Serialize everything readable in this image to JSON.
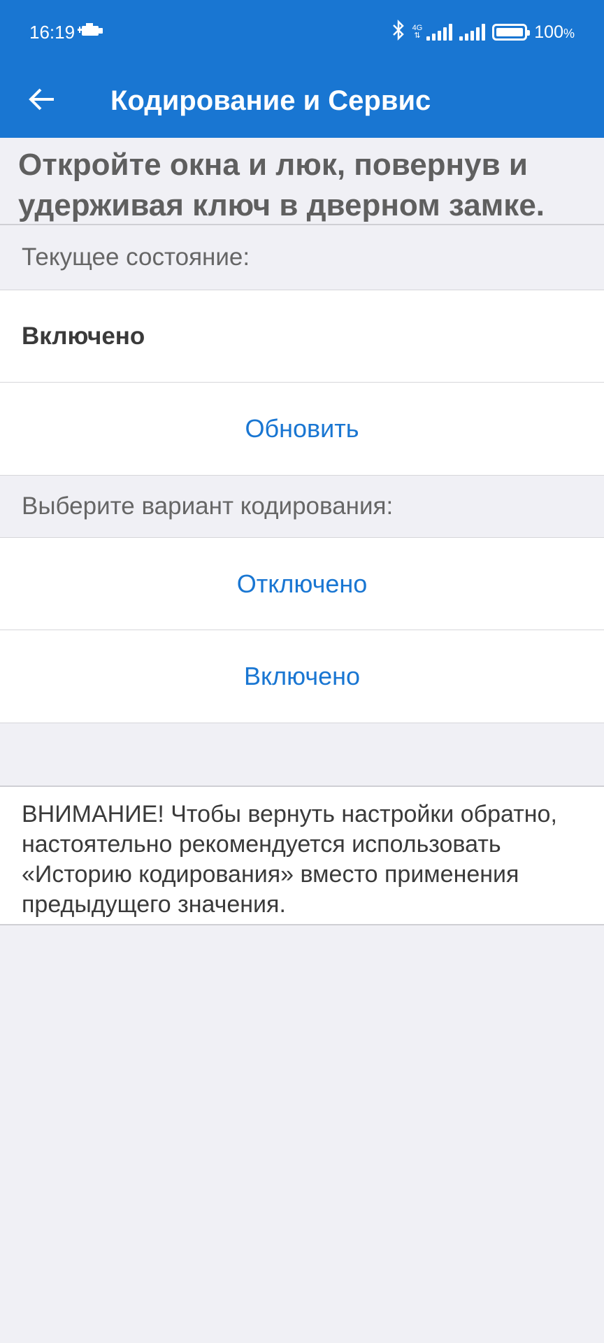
{
  "status_bar": {
    "time": "16:19",
    "network": "4G",
    "battery": "100",
    "battery_unit": "%",
    "icons": [
      "car-engine-icon",
      "bluetooth-icon",
      "signal-icon",
      "battery-icon"
    ]
  },
  "toolbar": {
    "title": "Кодирование и Сервис",
    "back_icon": "arrow-left-icon"
  },
  "instruction": "Откройте окна и люк, повернув и удерживая ключ в дверном замке.",
  "current_state": {
    "label": "Текущее состояние:",
    "value": "Включено",
    "refresh_label": "Обновить"
  },
  "coding": {
    "label": "Выберите вариант кодирования:",
    "options": [
      "Отключено",
      "Включено"
    ]
  },
  "warning": "ВНИМАНИЕ! Чтобы вернуть настройки обратно, настоятельно рекомендуется использовать «Историю кодирования» вместо применения предыдущего значения.",
  "colors": {
    "primary": "#1976d2",
    "background": "#f0f0f5"
  }
}
